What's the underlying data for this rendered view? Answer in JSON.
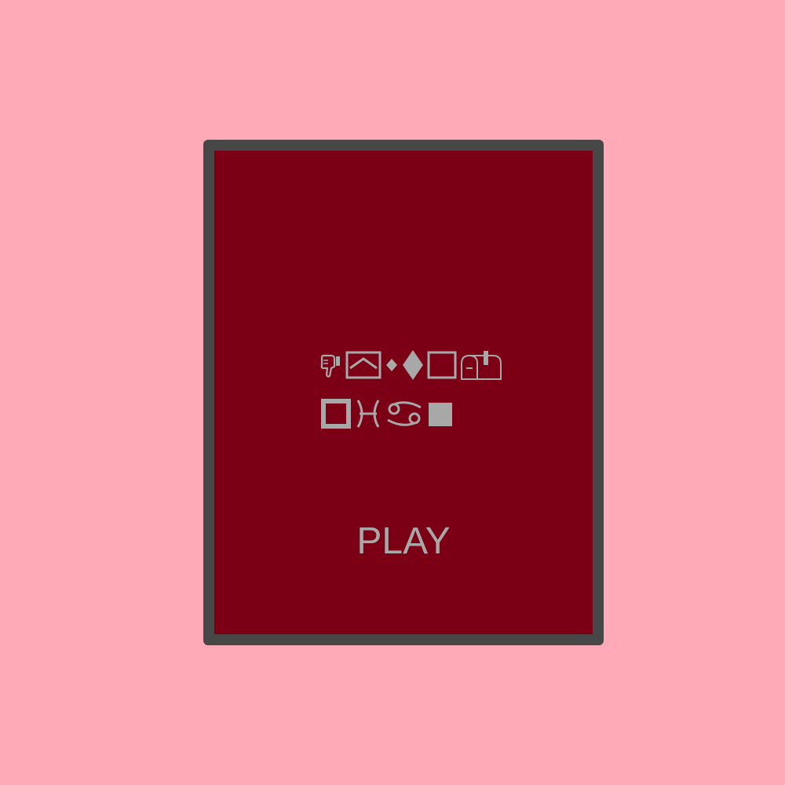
{
  "screen": {
    "background_color": "#ffaab6",
    "card_color": "#7c0015",
    "border_color": "#474747",
    "glyph_color": "#a8a8a8"
  },
  "title_symbols": {
    "row1": [
      "thumbs-down-icon",
      "picture-frame-icon",
      "small-diamond-icon",
      "diamond-icon",
      "square-outline-icon",
      "mailbox-icon"
    ],
    "row2": [
      "square-outline-thick-icon",
      "pisces-icon",
      "cancer-icon",
      "square-filled-icon"
    ]
  },
  "menu": {
    "play_label": "PLAY"
  }
}
